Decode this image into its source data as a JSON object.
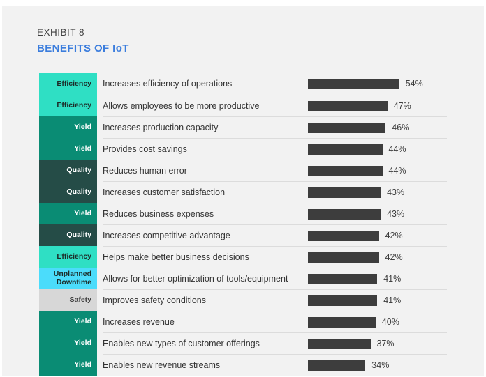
{
  "header": {
    "exhibit_number": "EXHIBIT 8",
    "title": "BENEFITS OF IoT"
  },
  "colors": {
    "accent_title": "#3b7ddd",
    "bar": "#3d3d3d",
    "background": "#f2f2f2",
    "efficiency": "#2fdfc4",
    "yield": "#0a8c74",
    "quality": "#254c47",
    "unplanned_downtime": "#4bdcfb",
    "safety": "#d7d7d7"
  },
  "chart_data": {
    "type": "bar",
    "title": "BENEFITS OF IoT",
    "subtitle": "EXHIBIT 8",
    "xlabel": "",
    "ylabel": "",
    "xlim": [
      0,
      60
    ],
    "grid": false,
    "legend": "none",
    "orientation": "horizontal",
    "value_suffix": "%",
    "categories": [
      "Increases efficiency of operations",
      "Allows employees to be more productive",
      "Increases production capacity",
      "Provides cost savings",
      "Reduces human error",
      "Increases customer satisfaction",
      "Reduces business expenses",
      "Increases competitive advantage",
      "Helps make better business decisions",
      "Allows for better optimization of tools/equipment",
      "Improves safety conditions",
      "Increases revenue",
      "Enables new types of customer offerings",
      "Enables new revenue streams"
    ],
    "values": [
      54,
      47,
      46,
      44,
      44,
      43,
      43,
      42,
      42,
      41,
      41,
      40,
      37,
      34
    ],
    "groups": [
      "Efficiency",
      "Efficiency",
      "Yield",
      "Yield",
      "Quality",
      "Quality",
      "Yield",
      "Quality",
      "Efficiency",
      "Unplanned Downtime",
      "Safety",
      "Yield",
      "Yield",
      "Yield"
    ]
  },
  "rows": [
    {
      "group": "Efficiency",
      "group_display": "Efficiency",
      "label": "Increases efficiency of operations",
      "value": 54,
      "value_label": "54%",
      "group_bg": "#2fdfc4",
      "group_fg": "#1d2b28",
      "group_first": true
    },
    {
      "group": "Efficiency",
      "group_display": "Efficiency",
      "label": "Allows employees to be more productive",
      "value": 47,
      "value_label": "47%",
      "group_bg": "#2fdfc4",
      "group_fg": "#1d2b28",
      "group_first": false
    },
    {
      "group": "Yield",
      "group_display": "Yield",
      "label": "Increases production capacity",
      "value": 46,
      "value_label": "46%",
      "group_bg": "#0a8c74",
      "group_fg": "#ffffff",
      "group_first": true
    },
    {
      "group": "Yield",
      "group_display": "Yield",
      "label": "Provides cost savings",
      "value": 44,
      "value_label": "44%",
      "group_bg": "#0a8c74",
      "group_fg": "#ffffff",
      "group_first": false
    },
    {
      "group": "Quality",
      "group_display": "Quality",
      "label": "Reduces human error",
      "value": 44,
      "value_label": "44%",
      "group_bg": "#254c47",
      "group_fg": "#ffffff",
      "group_first": true
    },
    {
      "group": "Quality",
      "group_display": "Quality",
      "label": "Increases customer satisfaction",
      "value": 43,
      "value_label": "43%",
      "group_bg": "#254c47",
      "group_fg": "#ffffff",
      "group_first": false
    },
    {
      "group": "Yield",
      "group_display": "Yield",
      "label": "Reduces business expenses",
      "value": 43,
      "value_label": "43%",
      "group_bg": "#0a8c74",
      "group_fg": "#ffffff",
      "group_first": true
    },
    {
      "group": "Quality",
      "group_display": "Quality",
      "label": "Increases competitive advantage",
      "value": 42,
      "value_label": "42%",
      "group_bg": "#254c47",
      "group_fg": "#ffffff",
      "group_first": true
    },
    {
      "group": "Efficiency",
      "group_display": "Efficiency",
      "label": "Helps make better business decisions",
      "value": 42,
      "value_label": "42%",
      "group_bg": "#2fdfc4",
      "group_fg": "#1d2b28",
      "group_first": true
    },
    {
      "group": "Unplanned Downtime",
      "group_display": "Unplanned\nDowntime",
      "label": "Allows for better optimization of tools/equipment",
      "value": 41,
      "value_label": "41%",
      "group_bg": "#4bdcfb",
      "group_fg": "#1d2b28",
      "group_first": true
    },
    {
      "group": "Safety",
      "group_display": "Safety",
      "label": "Improves safety conditions",
      "value": 41,
      "value_label": "41%",
      "group_bg": "#d7d7d7",
      "group_fg": "#3f3f3f",
      "group_first": true
    },
    {
      "group": "Yield",
      "group_display": "Yield",
      "label": "Increases revenue",
      "value": 40,
      "value_label": "40%",
      "group_bg": "#0a8c74",
      "group_fg": "#ffffff",
      "group_first": true
    },
    {
      "group": "Yield",
      "group_display": "Yield",
      "label": "Enables new types of customer offerings",
      "value": 37,
      "value_label": "37%",
      "group_bg": "#0a8c74",
      "group_fg": "#ffffff",
      "group_first": false
    },
    {
      "group": "Yield",
      "group_display": "Yield",
      "label": "Enables new revenue streams",
      "value": 34,
      "value_label": "34%",
      "group_bg": "#0a8c74",
      "group_fg": "#ffffff",
      "group_first": false
    }
  ]
}
